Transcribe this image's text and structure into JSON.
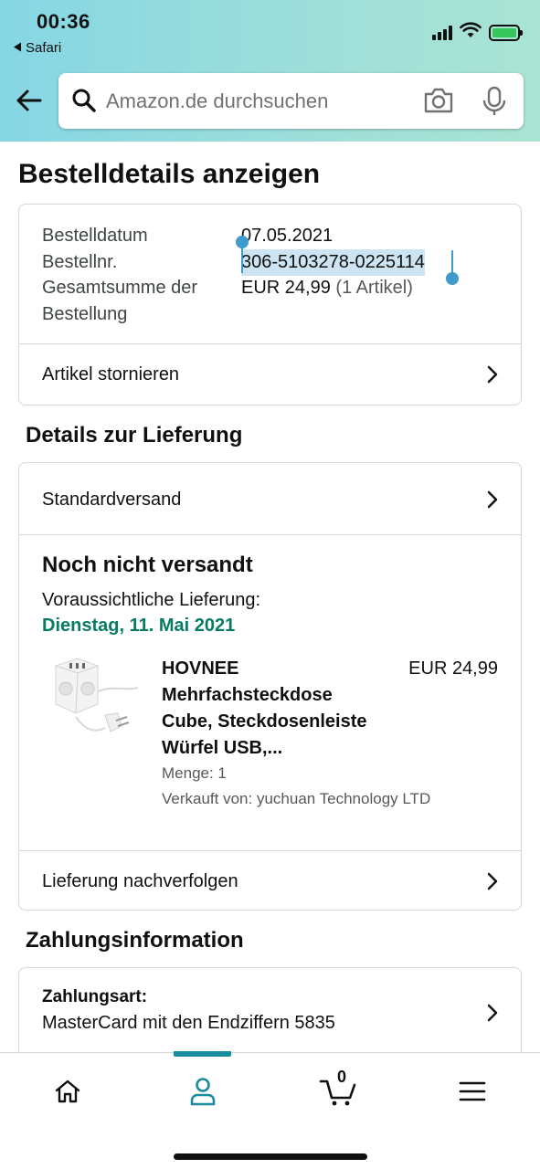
{
  "status_bar": {
    "time": "00:36",
    "back_app": "Safari"
  },
  "header": {
    "search_placeholder": "Amazon.de durchsuchen"
  },
  "page": {
    "title": "Bestelldetails anzeigen"
  },
  "order": {
    "date_label": "Bestelldatum",
    "date_value": "07.05.2021",
    "number_label": "Bestellnr.",
    "number_value": "306-5103278-0225114",
    "total_label_line1": "Gesamtsumme der",
    "total_label_line2": "Bestellung",
    "total_value": "EUR 24,99",
    "total_items": "(1 Artikel)",
    "cancel_label": "Artikel stornieren"
  },
  "delivery": {
    "section_title": "Details zur Lieferung",
    "shipping_method": "Standardversand",
    "status": "Noch nicht versandt",
    "eta_label": "Voraussichtliche Lieferung:",
    "eta_date": "Dienstag, 11. Mai 2021",
    "product": {
      "name_line1": "HOVNEE",
      "name_line2": "Mehrfachsteckdose",
      "name_line3": "Cube, Steckdosenleiste",
      "name_line4": "Würfel USB,...",
      "price": "EUR 24,99",
      "quantity": "Menge: 1",
      "seller": "Verkauft von: yuchuan Technology LTD"
    },
    "track_label": "Lieferung nachverfolgen"
  },
  "payment": {
    "section_title": "Zahlungsinformation",
    "method_label": "Zahlungsart:",
    "method_value": "MasterCard mit den Endziffern 5835"
  },
  "bottom_nav": {
    "cart_count": "0",
    "active_tab": "account",
    "accent_color": "#1a8ca0"
  },
  "colors": {
    "delivery_date": "#067d62",
    "selection": "#cde4f2",
    "selection_handle": "#3f9bc9"
  }
}
